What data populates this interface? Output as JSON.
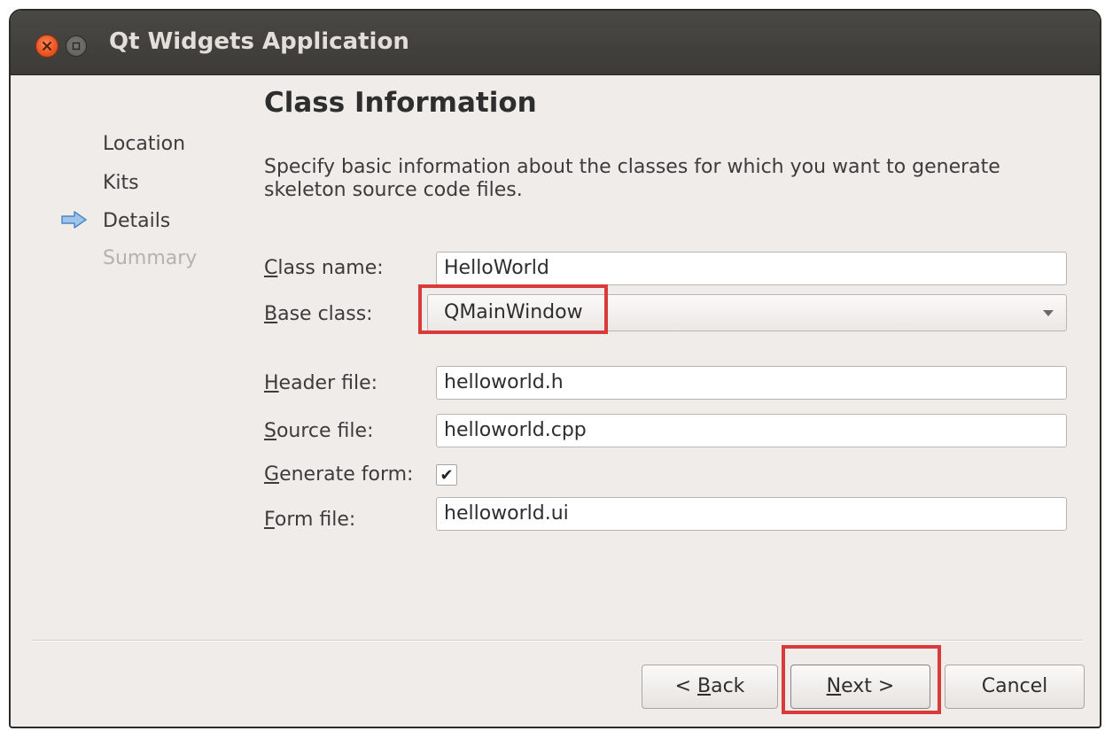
{
  "window": {
    "title": "Qt Widgets Application",
    "accent_color": "#e85421",
    "highlight_color": "#d93a3a"
  },
  "titlebar": {
    "close_icon": "close-icon",
    "minimize_icon": "minimize-icon"
  },
  "sidebar": {
    "items": [
      {
        "label": "Location",
        "state": "done"
      },
      {
        "label": "Kits",
        "state": "done"
      },
      {
        "label": "Details",
        "state": "current"
      },
      {
        "label": "Summary",
        "state": "disabled"
      }
    ],
    "current_icon": "arrow-right-icon"
  },
  "page": {
    "title": "Class Information",
    "description": "Specify basic information about the classes for which you want to generate skeleton source code files."
  },
  "form": {
    "class_name": {
      "label_mnemonic": "C",
      "label_rest": "lass name:",
      "value": "HelloWorld"
    },
    "base_class": {
      "label_mnemonic": "B",
      "label_rest": "ase class:",
      "value": "QMainWindow"
    },
    "header_file": {
      "label_mnemonic": "H",
      "label_rest": "eader file:",
      "value": "helloworld.h"
    },
    "source_file": {
      "label_mnemonic": "S",
      "label_rest": "ource file:",
      "value": "helloworld.cpp"
    },
    "generate_form": {
      "label_mnemonic": "G",
      "label_rest": "enerate form:",
      "checked_glyph": "✔"
    },
    "form_file": {
      "label_mnemonic": "F",
      "label_rest": "orm file:",
      "value": "helloworld.ui"
    }
  },
  "buttons": {
    "back": {
      "prefix": "< ",
      "mnemonic": "B",
      "rest": "ack"
    },
    "next": {
      "mnemonic": "N",
      "rest": "ext >"
    },
    "cancel": {
      "label": "Cancel"
    }
  }
}
